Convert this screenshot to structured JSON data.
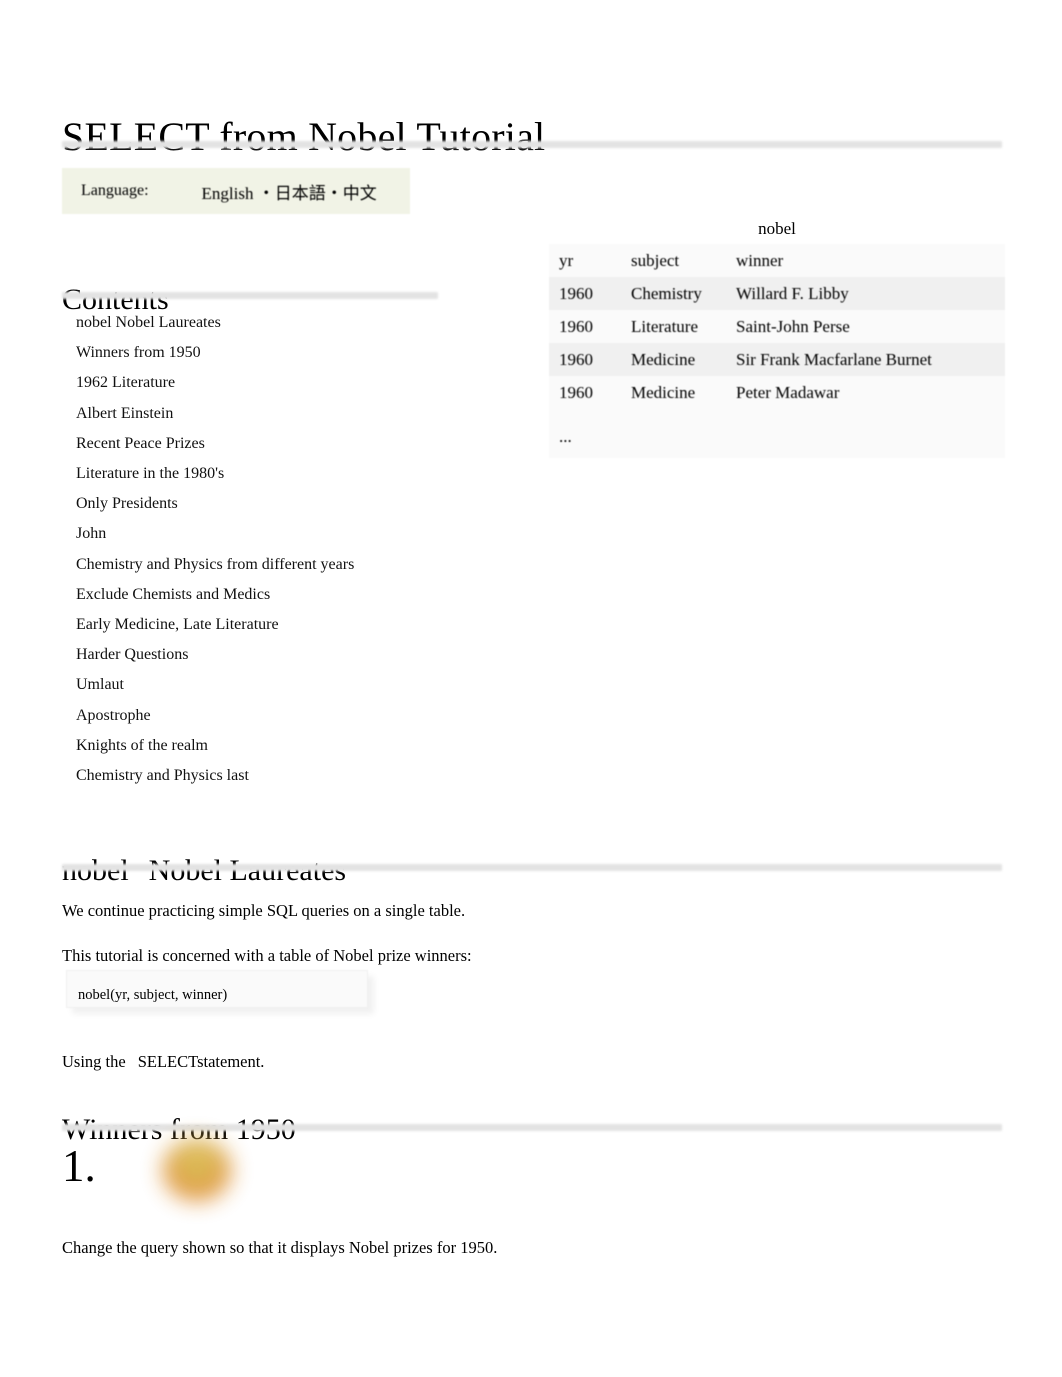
{
  "page": {
    "title": "SELECT from Nobel Tutorial"
  },
  "language_bar": {
    "label": "Language:",
    "options": [
      "English",
      "・日本語",
      "・中文"
    ],
    "links_text": "English   ・日本語・中文",
    "background_color": "#f1f3e6"
  },
  "contents": {
    "heading": "Contents",
    "items": [
      {
        "label": "nobel Nobel Laureates"
      },
      {
        "label": "Winners from 1950"
      },
      {
        "label": "1962 Literature"
      },
      {
        "label": "Albert Einstein"
      },
      {
        "label": "Recent Peace Prizes"
      },
      {
        "label": "Literature in the 1980's"
      },
      {
        "label": "Only Presidents"
      },
      {
        "label": "John"
      },
      {
        "label": "Chemistry and Physics from different years"
      },
      {
        "label": "Exclude Chemists and Medics"
      },
      {
        "label": "Early Medicine, Late Literature"
      },
      {
        "label": "Harder Questions"
      },
      {
        "label": "Umlaut"
      },
      {
        "label": "Apostrophe"
      },
      {
        "label": "Knights of the realm"
      },
      {
        "label": "Chemistry and Physics last"
      }
    ]
  },
  "nobel_table": {
    "caption": "nobel",
    "columns": [
      "yr",
      "subject",
      "winner"
    ],
    "rows": [
      [
        "1960",
        "Chemistry",
        "Willard F. Libby"
      ],
      [
        "1960",
        "Literature",
        "Saint-John Perse"
      ],
      [
        "1960",
        "Medicine",
        "Sir Frank Macfarlane Burnet"
      ],
      [
        "1960",
        "Medicine",
        "Peter Madawar"
      ]
    ],
    "ellipsis": "..."
  },
  "section_nobel": {
    "heading_code": "nobel",
    "heading_text": "Nobel Laureates",
    "paragraph1": "We continue practicing simple SQL queries on a single table.",
    "paragraph2": "This tutorial is concerned with a table of Nobel prize winners:",
    "code_block": "nobel(yr, subject, winner)",
    "using_prefix": "Using the",
    "using_keyword": "SELECT",
    "using_suffix": "statement."
  },
  "section_winners": {
    "heading": "Winners from 1950",
    "question_number": "1.",
    "medal_icon": "nobel-medal-icon",
    "medal_colors": [
      "#ddc055",
      "#e08b33"
    ],
    "question_text": "Change the query shown so that it displays Nobel prizes for 1950."
  },
  "theme": {
    "rule_color": "#e3e3e3",
    "table_row_light": "#fafafa",
    "table_row_dark": "#f0f0f0",
    "code_bg": "#fafafa"
  }
}
